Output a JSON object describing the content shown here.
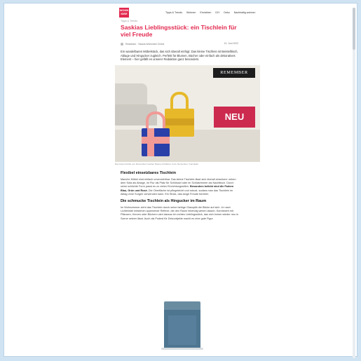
{
  "header": {
    "logo_text": "WOHN IDEE",
    "nav": [
      "Tipps & Trends",
      "Wohnen",
      "Einrichten",
      "DIY",
      "Deko",
      "Nachhaltig wohnen"
    ]
  },
  "article": {
    "category": "Tipps & Trends",
    "title": "Saskias Lieblingsstück: ein Tischlein für viel Freude",
    "author": "Redaktion · Saskia Wohnidee Online",
    "date": "10. Juni 2022",
    "intro": "Ein wandelbares Möbelstück, das sich überall einfügt: Das kleine Tischlein ist Beistelltisch, Ablage und Hingucker zugleich. Perfekt für Blumen, Bücher oder einfach als dekoratives Element – hier gefällt es unserer Redaktion ganz besonders."
  },
  "hero": {
    "brand_label": "REMEMBER",
    "badge_label": "NEU",
    "caption": "Die bunten Körbe von Remember machen Räume fröhlicher. Foto: Remember / Hersteller"
  },
  "body": {
    "section1_heading": "Flexibel einsetzbares Tischlein",
    "section1_text": "Manche Möbel sind einfach unverzichtbar. Das kleine Tischlein lässt sich überall einsetzen: neben dem Sofa als Ablage, im Flur als Platz für Schlüssel oder im Schlafzimmer als Nachttisch. Durch seine schlichte Form passt es zu vielen Einrichtungsstilen.",
    "section1_highlight": "Besonders beliebt sind die Farben Blau, Grün und Rosé.",
    "section1_text2": "Die Oberfläche ist pflegeleicht und robust, sodass man das Tischlein im Alltag ohne Sorgen verwenden kann. Ein Stück, das lange Freude bereitet.",
    "section2_heading": "Die schmucke Tischlein als Hingucker im Raum",
    "section2_text": "Im Wohnzimmer zieht das Tischlein durch seine farbige Glasoptik die Blicke auf sich. Je nach Lichteinfall entstehen spannende Reflexe, die den Raum lebendig wirken lassen. Kombiniert mit Pflanzen, Kerzen oder Büchern wird daraus ein echtes Lieblingsstück, das sich immer wieder neu in Szene setzen lässt. Auch als Podest für Dekoobjekte macht es eine gute Figur."
  },
  "colors": {
    "accent": "#e2294f",
    "badge": "#cc2a4f",
    "page_bg": "#cfe3f2"
  }
}
